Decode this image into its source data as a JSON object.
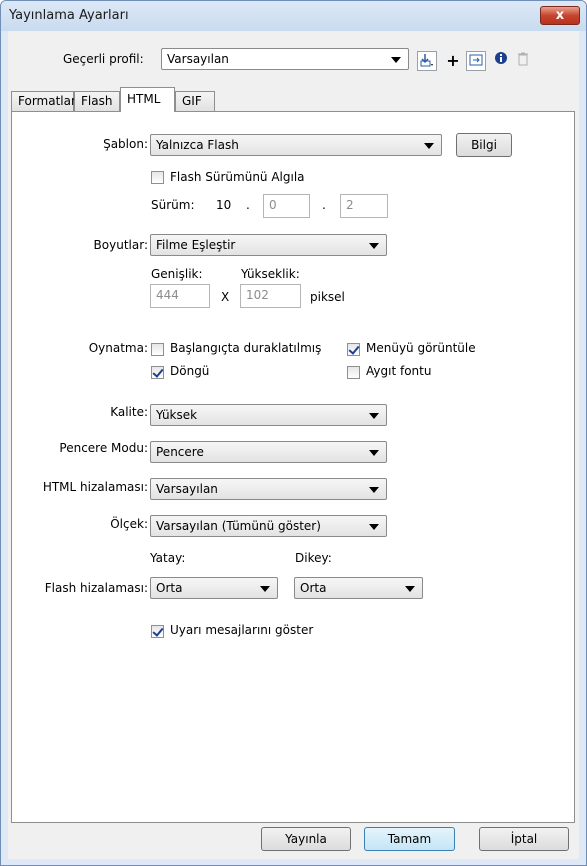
{
  "window": {
    "title": "Yayınlama Ayarları",
    "close_label": "x"
  },
  "profile": {
    "label": "Geçerli profil:",
    "value": "Varsayılan"
  },
  "toolbar": {
    "import_icon": "import-export-icon",
    "add_icon": "plus-icon",
    "duplicate_icon": "duplicate-icon",
    "info_icon": "info-icon",
    "delete_icon": "trash-icon"
  },
  "tabs": [
    {
      "label": "Formatlar"
    },
    {
      "label": "Flash"
    },
    {
      "label": "HTML"
    },
    {
      "label": "GIF"
    }
  ],
  "template": {
    "label": "Şablon:",
    "value": "Yalnızca Flash",
    "info_button": "Bilgi"
  },
  "detect_version": {
    "label": "Flash Sürümünü Algıla",
    "checked": false
  },
  "version": {
    "label": "Sürüm:",
    "major": "10",
    "sep1": ".",
    "minor": "0",
    "sep2": ".",
    "revision": "2"
  },
  "dimensions": {
    "label": "Boyutlar:",
    "value": "Filme Eşleştir",
    "width_label": "Genişlik:",
    "height_label": "Yükseklik:",
    "width": "444",
    "x_sep": "X",
    "height": "102",
    "unit": "piksel"
  },
  "playback": {
    "label": "Oynatma:",
    "paused": "Başlangıçta duraklatılmış",
    "paused_checked": false,
    "menu": "Menüyü görüntüle",
    "menu_checked": true,
    "loop": "Döngü",
    "loop_checked": true,
    "device_font": "Aygıt fontu",
    "device_font_checked": false
  },
  "quality": {
    "label": "Kalite:",
    "value": "Yüksek"
  },
  "window_mode": {
    "label": "Pencere Modu:",
    "value": "Pencere"
  },
  "html_align": {
    "label": "HTML hizalaması:",
    "value": "Varsayılan"
  },
  "scale": {
    "label": "Ölçek:",
    "value": "Varsayılan (Tümünü göster)"
  },
  "flash_align": {
    "label": "Flash hizalaması:",
    "horizontal_label": "Yatay:",
    "horizontal": "Orta",
    "vertical_label": "Dikey:",
    "vertical": "Orta"
  },
  "warnings": {
    "label": "Uyarı mesajlarını göster",
    "checked": true
  },
  "buttons": {
    "publish": "Yayınla",
    "ok": "Tamam",
    "cancel": "İptal"
  },
  "colors": {
    "title_bar": "#c9dbef",
    "close_button": "#c7452f",
    "dialog_bg": "#f0f0f0",
    "check_mark": "#1c3f94"
  }
}
